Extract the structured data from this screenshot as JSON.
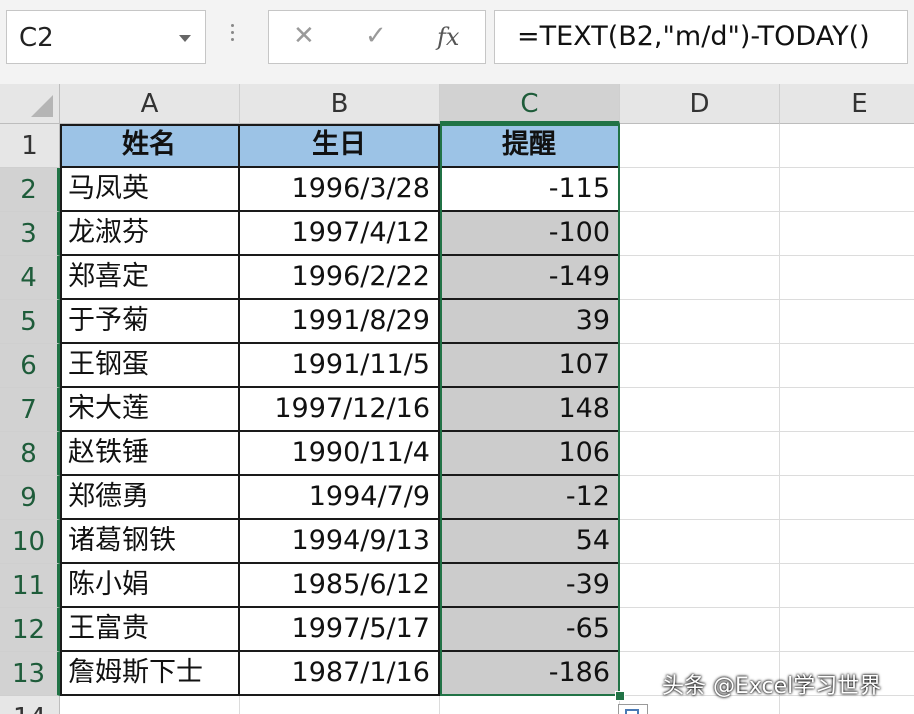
{
  "formula_bar": {
    "name_box": "C2",
    "cancel_icon": "✕",
    "enter_icon": "✓",
    "fx_label": "fx",
    "formula": "=TEXT(B2,\"m/d\")-TODAY()"
  },
  "columns": [
    "A",
    "B",
    "C",
    "D",
    "E"
  ],
  "rows": [
    "1",
    "2",
    "3",
    "4",
    "5",
    "6",
    "7",
    "8",
    "9",
    "10",
    "11",
    "12",
    "13",
    "14"
  ],
  "headers": {
    "name": "姓名",
    "birthday": "生日",
    "reminder": "提醒"
  },
  "data": [
    {
      "name": "马凤英",
      "birthday": "1996/3/28",
      "reminder": "-115"
    },
    {
      "name": "龙淑芬",
      "birthday": "1997/4/12",
      "reminder": "-100"
    },
    {
      "name": "郑喜定",
      "birthday": "1996/2/22",
      "reminder": "-149"
    },
    {
      "name": "于予菊",
      "birthday": "1991/8/29",
      "reminder": "39"
    },
    {
      "name": "王钢蛋",
      "birthday": "1991/11/5",
      "reminder": "107"
    },
    {
      "name": "宋大莲",
      "birthday": "1997/12/16",
      "reminder": "148"
    },
    {
      "name": "赵铁锤",
      "birthday": "1990/11/4",
      "reminder": "106"
    },
    {
      "name": "郑德勇",
      "birthday": "1994/7/9",
      "reminder": "-12"
    },
    {
      "name": "诸葛钢铁",
      "birthday": "1994/9/13",
      "reminder": "54"
    },
    {
      "name": "陈小娟",
      "birthday": "1985/6/12",
      "reminder": "-39"
    },
    {
      "name": "王富贵",
      "birthday": "1997/5/17",
      "reminder": "-65"
    },
    {
      "name": "詹姆斯下士",
      "birthday": "1987/1/16",
      "reminder": "-186"
    }
  ],
  "selection": {
    "active_cell": "C2",
    "range": "C2:C13"
  },
  "colors": {
    "accent": "#217346",
    "header_fill": "#9cc3e6",
    "selected_fill": "#cccccc"
  },
  "watermark": "头条 @Excel学习世界"
}
